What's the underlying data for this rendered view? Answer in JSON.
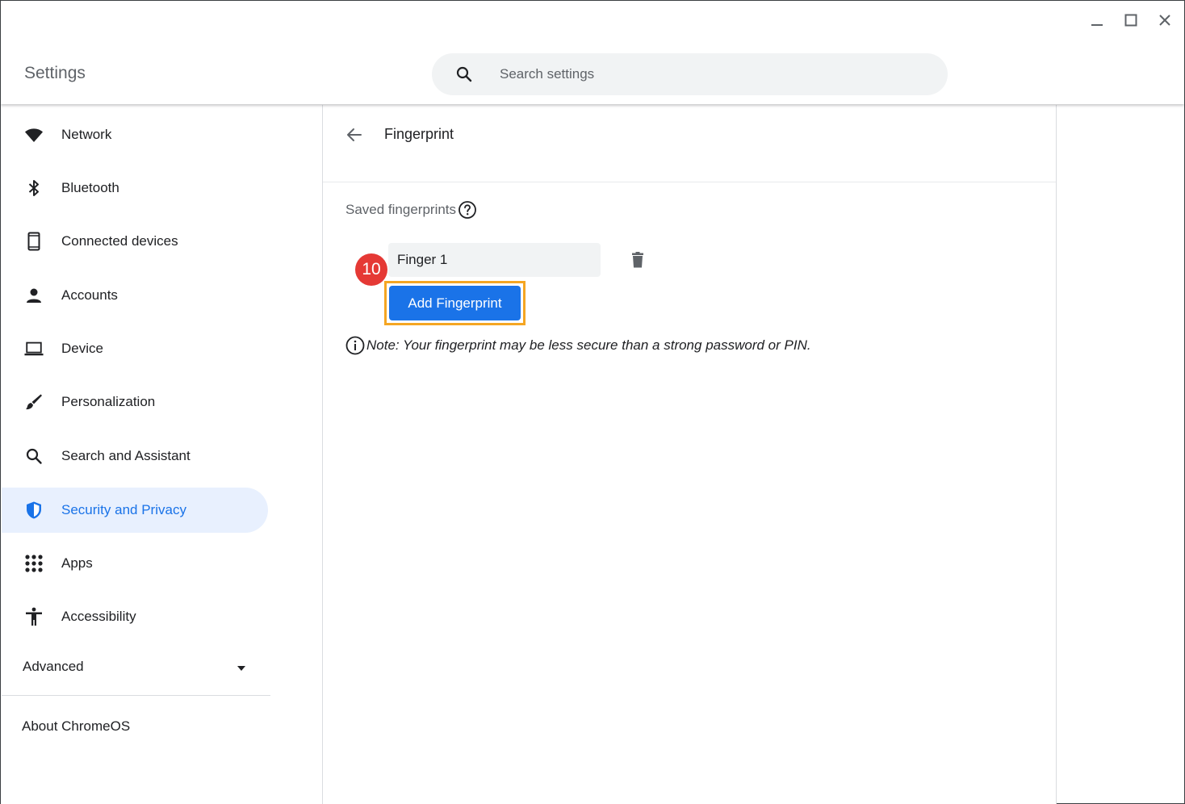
{
  "window": {
    "title": "Settings",
    "controls": [
      "minimize",
      "maximize",
      "close"
    ]
  },
  "search": {
    "placeholder": "Search settings",
    "value": ""
  },
  "sidebar": {
    "items": [
      {
        "label": "Network",
        "icon": "wifi-icon"
      },
      {
        "label": "Bluetooth",
        "icon": "bluetooth-icon"
      },
      {
        "label": "Connected devices",
        "icon": "phone-icon"
      },
      {
        "label": "Accounts",
        "icon": "person-icon"
      },
      {
        "label": "Device",
        "icon": "laptop-icon"
      },
      {
        "label": "Personalization",
        "icon": "brush-icon"
      },
      {
        "label": "Search and Assistant",
        "icon": "search-icon"
      },
      {
        "label": "Security and Privacy",
        "icon": "shield-icon",
        "active": true
      },
      {
        "label": "Apps",
        "icon": "apps-grid-icon"
      },
      {
        "label": "Accessibility",
        "icon": "accessibility-icon"
      }
    ],
    "advanced_label": "Advanced",
    "about_label": "About ChromeOS"
  },
  "main": {
    "page_title": "Fingerprint",
    "saved_label": "Saved fingerprints",
    "fingerprints": [
      {
        "name": "Finger 1"
      }
    ],
    "add_button_label": "Add Fingerprint",
    "step_badge": "10",
    "note": "Note: Your fingerprint may be less secure than a strong password or PIN."
  },
  "colors": {
    "accent": "#1a73e8",
    "active_bg": "#e8f0fe",
    "highlight": "#f5a623",
    "badge": "#e53935"
  }
}
